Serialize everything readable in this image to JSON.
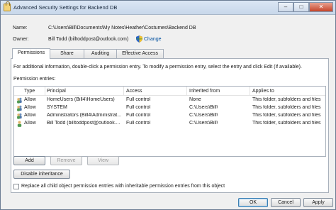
{
  "window": {
    "title": "Advanced Security Settings for Backend DB",
    "controls": {
      "minimize": "–",
      "maximize": "□",
      "close": "✕"
    }
  },
  "details": {
    "name_label": "Name:",
    "name_value": "C:\\Users\\Bill\\Documents\\My Notes\\Heather\\Costumes\\Backend DB",
    "owner_label": "Owner:",
    "owner_value": "Bill Todd (billtoddpost@outlook.com)",
    "change_link": "Change"
  },
  "tabs": [
    {
      "label": "Permissions",
      "active": true
    },
    {
      "label": "Share",
      "active": false
    },
    {
      "label": "Auditing",
      "active": false
    },
    {
      "label": "Effective Access",
      "active": false
    }
  ],
  "permissions": {
    "info_text": "For additional information, double-click a permission entry. To modify a permission entry, select the entry and click Edit (if available).",
    "entries_label": "Permission entries:",
    "columns": [
      "Type",
      "Principal",
      "Access",
      "Inherited from",
      "Applies to"
    ],
    "rows": [
      {
        "icon": "group-icon",
        "type": "Allow",
        "principal": "HomeUsers (Bill4\\HomeUsers)",
        "access": "Full control",
        "inherited": "None",
        "applies": "This folder, subfolders and files"
      },
      {
        "icon": "group-icon",
        "type": "Allow",
        "principal": "SYSTEM",
        "access": "Full control",
        "inherited": "C:\\Users\\Bill\\",
        "applies": "This folder, subfolders and files"
      },
      {
        "icon": "group-icon",
        "type": "Allow",
        "principal": "Administrators (Bill4\\Administrat...",
        "access": "Full control",
        "inherited": "C:\\Users\\Bill\\",
        "applies": "This folder, subfolders and files"
      },
      {
        "icon": "user-icon",
        "type": "Allow",
        "principal": "Bill Todd (billtoddpost@outlook....",
        "access": "Full control",
        "inherited": "C:\\Users\\Bill\\",
        "applies": "This folder, subfolders and files"
      }
    ],
    "buttons": {
      "add": "Add",
      "remove": "Remove",
      "view": "View",
      "disable_inheritance": "Disable inheritance"
    },
    "replace_checkbox_label": "Replace all child object permission entries with inheritable permission entries from this object"
  },
  "footer": {
    "ok": "OK",
    "cancel": "Cancel",
    "apply": "Apply"
  }
}
